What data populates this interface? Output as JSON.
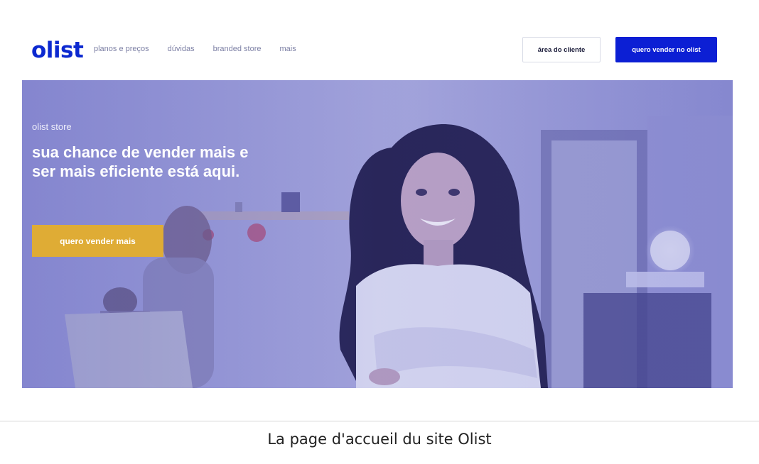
{
  "header": {
    "logo": "olist",
    "nav": [
      {
        "label": "planos e preços"
      },
      {
        "label": "dúvidas"
      },
      {
        "label": "branded store"
      },
      {
        "label": "mais"
      }
    ],
    "client_button": "área do cliente",
    "sell_button": "quero vender no olist"
  },
  "hero": {
    "eyebrow": "olist store",
    "title": "sua chance de vender mais e ser mais eficiente está aqui.",
    "cta": "quero vender mais"
  },
  "caption": "La page d'accueil du site Olist",
  "colors": {
    "brand_blue": "#0c1fd4",
    "cta_yellow": "#dfac35",
    "hero_tint": "#8c8ed0"
  }
}
